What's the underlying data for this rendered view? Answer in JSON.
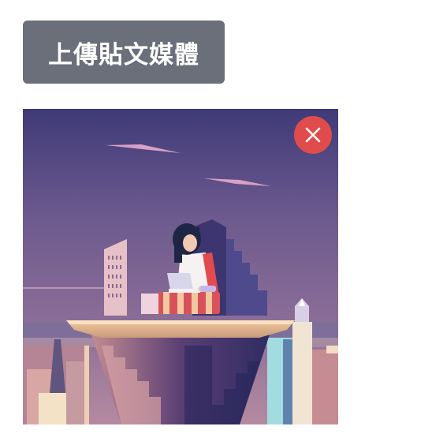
{
  "upload_button": {
    "label": "上傳貼文媒體",
    "color": "#6b6f79"
  },
  "media_item": {
    "image_icon": "illustration-person-laptop-rooftop-city",
    "remove_icon": "close-icon",
    "remove_color": "#e04b4b"
  }
}
